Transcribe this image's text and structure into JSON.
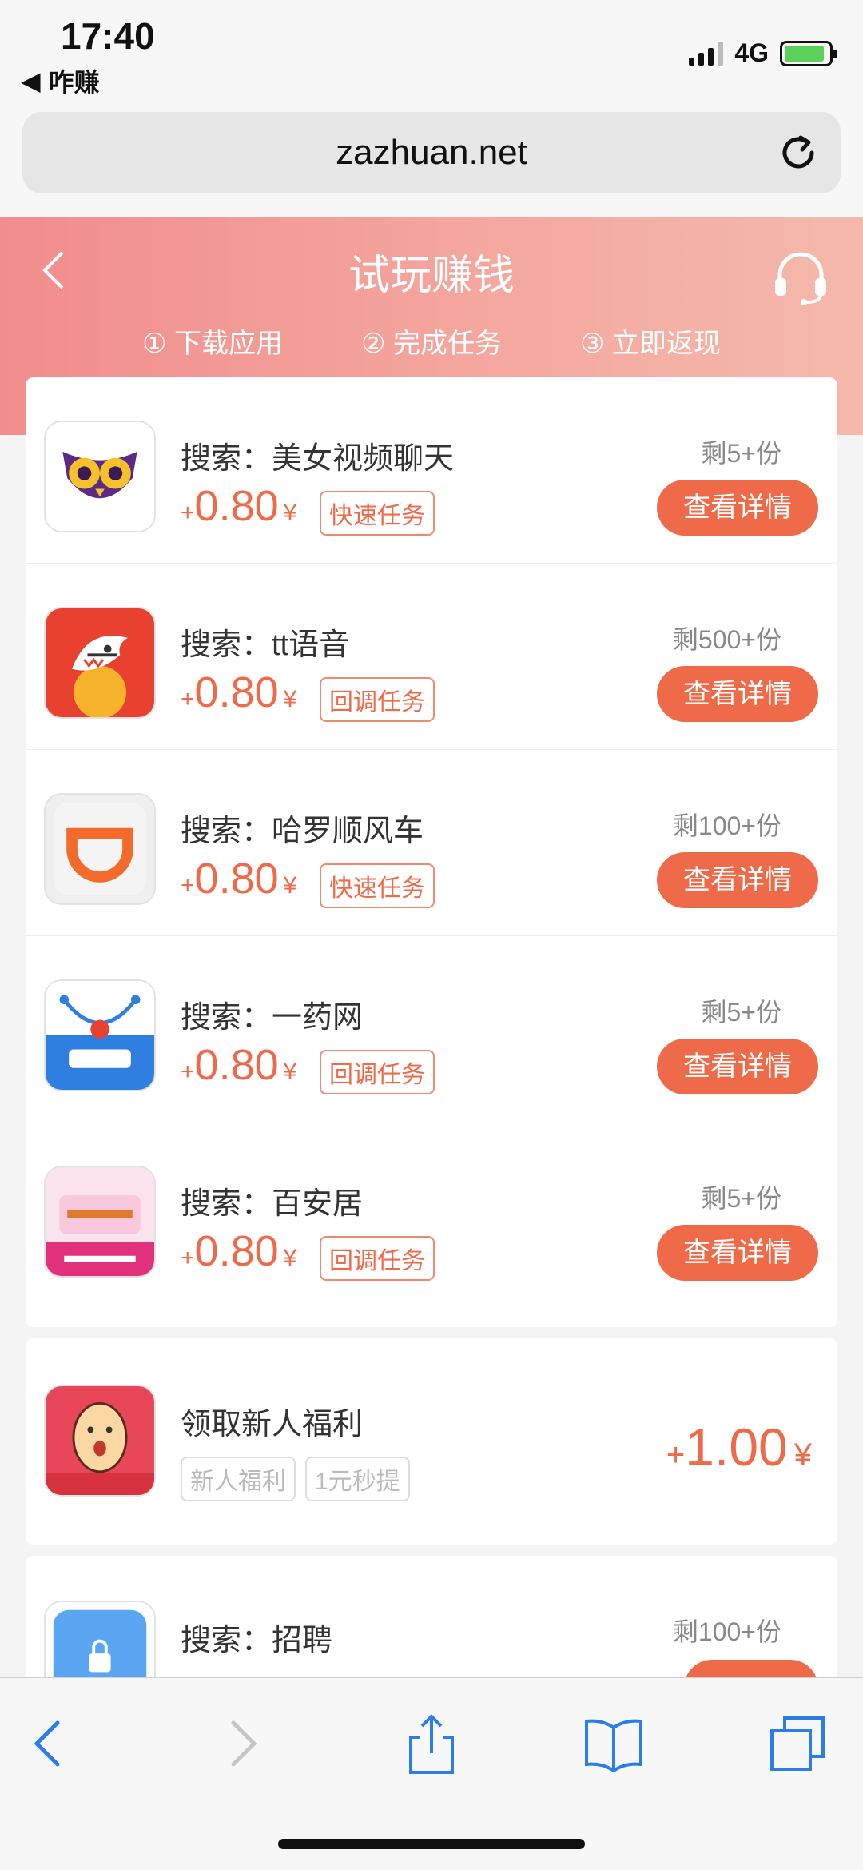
{
  "status_bar": {
    "time": "17:40",
    "back_app": "咋赚",
    "network": "4G",
    "battery_percent": 90
  },
  "browser": {
    "url": "zazhuan.net"
  },
  "header": {
    "title": "试玩赚钱",
    "steps": [
      "① 下载应用",
      "② 完成任务",
      "③ 立即返现"
    ]
  },
  "tasks": [
    {
      "name": "搜索：美女视频聊天",
      "plus": "+",
      "amount": "0.80",
      "yen": "¥",
      "tag": "快速任务",
      "remaining": "剩5+份",
      "button": "查看详情",
      "icon": "owl-app-icon"
    },
    {
      "name": "搜索：tt语音",
      "plus": "+",
      "amount": "0.80",
      "yen": "¥",
      "tag": "回调任务",
      "remaining": "剩500+份",
      "button": "查看详情",
      "icon": "shark-app-icon"
    },
    {
      "name": "搜索：哈罗顺风车",
      "plus": "+",
      "amount": "0.80",
      "yen": "¥",
      "tag": "快速任务",
      "remaining": "剩100+份",
      "button": "查看详情",
      "icon": "didi-app-icon"
    },
    {
      "name": "搜索：一药网",
      "plus": "+",
      "amount": "0.80",
      "yen": "¥",
      "tag": "回调任务",
      "remaining": "剩5+份",
      "button": "查看详情",
      "icon": "jianke-app-icon"
    },
    {
      "name": "搜索：百安居",
      "plus": "+",
      "amount": "0.80",
      "yen": "¥",
      "tag": "回调任务",
      "remaining": "剩5+份",
      "button": "查看详情",
      "icon": "aikongjian-app-icon"
    }
  ],
  "bonus": {
    "name": "领取新人福利",
    "tags": [
      "新人福利",
      "1元秒提"
    ],
    "plus": "+",
    "amount": "1.00",
    "yen": "¥",
    "icon": "egg-face-app-icon"
  },
  "partial_task": {
    "name": "搜索：招聘",
    "remaining": "剩100+份",
    "icon": "lock-app-icon"
  }
}
